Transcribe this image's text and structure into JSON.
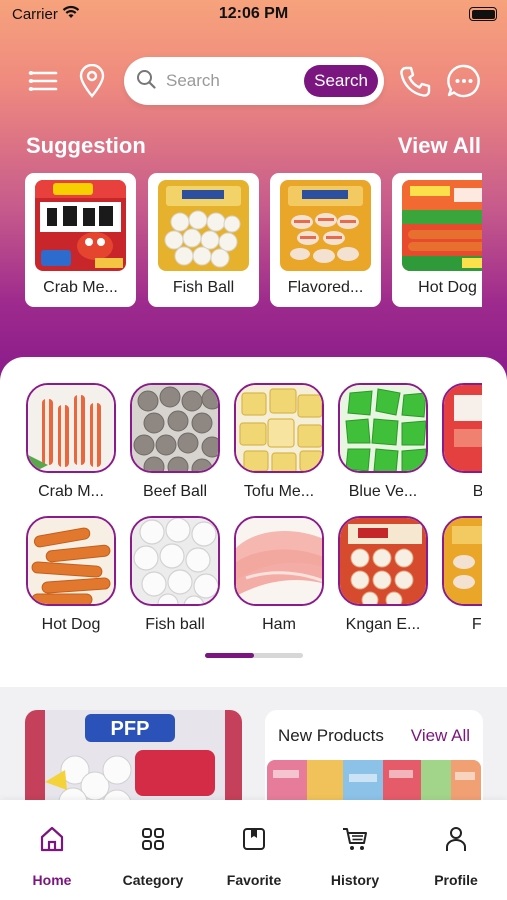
{
  "status_bar": {
    "carrier": "Carrier",
    "time": "12:06 PM"
  },
  "search": {
    "placeholder": "Search",
    "button_label": "Search"
  },
  "suggestion": {
    "title": "Suggestion",
    "view_all": "View All",
    "items": [
      {
        "label": "Crab Me..."
      },
      {
        "label": "Fish Ball"
      },
      {
        "label": "Flavored..."
      },
      {
        "label": "Hot Dog"
      }
    ]
  },
  "categories": {
    "row1": [
      {
        "label": "Crab  M..."
      },
      {
        "label": "Beef Ball"
      },
      {
        "label": "Tofu Me..."
      },
      {
        "label": "Blue Ve..."
      },
      {
        "label": "Batt"
      }
    ],
    "row2": [
      {
        "label": "Hot Dog"
      },
      {
        "label": "Fish ball"
      },
      {
        "label": "Ham"
      },
      {
        "label": "Kngan E..."
      },
      {
        "label": "Flav"
      }
    ],
    "page_progress": 0.5
  },
  "new_products": {
    "title": "New Products",
    "view_all": "View All"
  },
  "tabbar": {
    "tabs": [
      {
        "label": "Home",
        "active": true
      },
      {
        "label": "Category"
      },
      {
        "label": "Favorite"
      },
      {
        "label": "History"
      },
      {
        "label": "Profile"
      }
    ]
  },
  "colors": {
    "accent": "#7b157f",
    "gradient_top": "#f6a27c",
    "gradient_bottom": "#8a1b8a"
  }
}
